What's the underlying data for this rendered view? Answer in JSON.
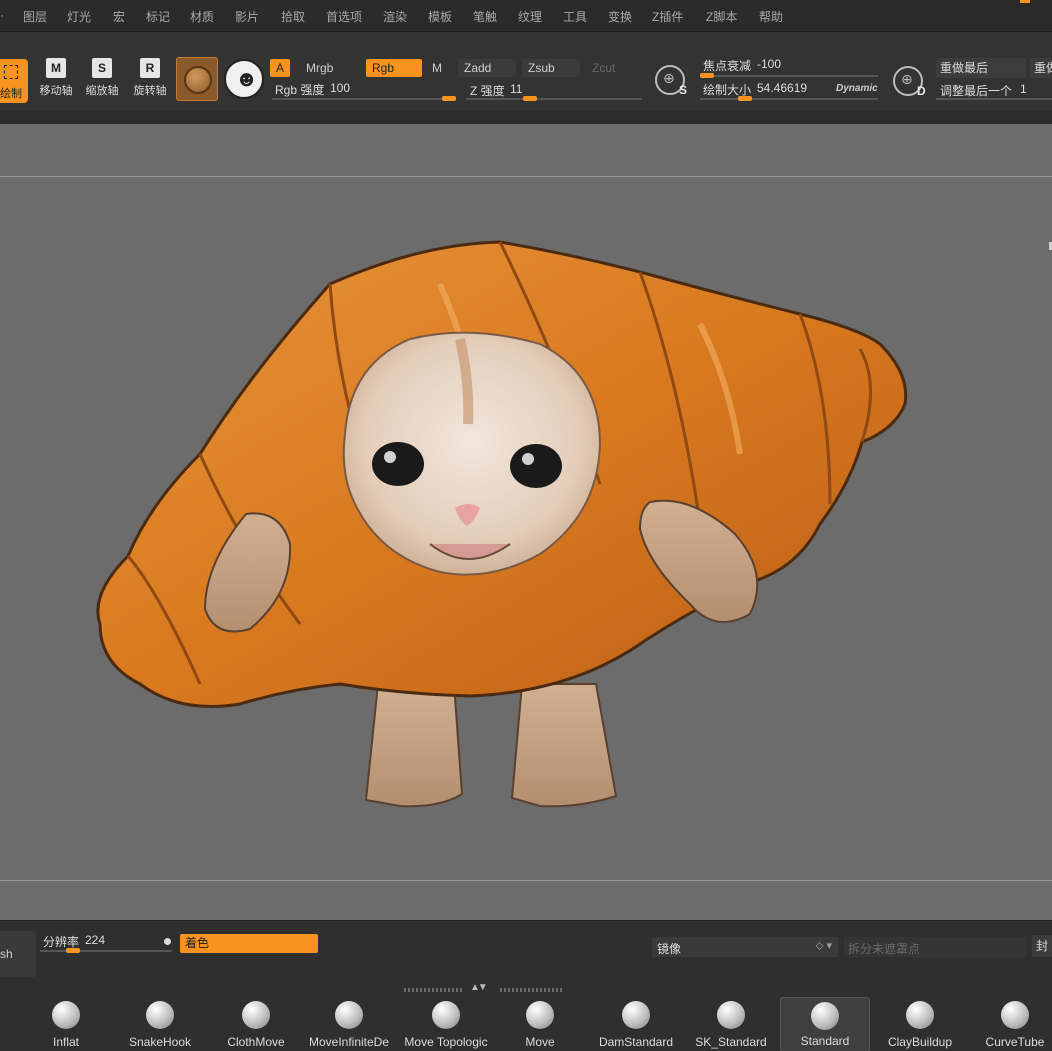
{
  "menu": {
    "items": [
      "图层",
      "灯光",
      "宏",
      "标记",
      "材质",
      "影片",
      "拾取",
      "首选项",
      "渲染",
      "模板",
      "笔触",
      "纹理",
      "工具",
      "变换",
      "Z插件",
      "Z脚本",
      "帮助"
    ]
  },
  "toolbar": {
    "draw_label": "绘制",
    "move_key": "M",
    "move_label": "移动轴",
    "scale_key": "S",
    "scale_label": "缩放轴",
    "rotate_key": "R",
    "rotate_label": "旋转轴",
    "a_label": "A",
    "mrgb_label": "Mrgb",
    "rgb_label": "Rgb",
    "m_label": "M",
    "zadd_label": "Zadd",
    "zsub_label": "Zsub",
    "zcut_label": "Zcut",
    "rgb_intensity_label": "Rgb 强度",
    "rgb_intensity_value": "100",
    "rgb_intensity_level": 1.0,
    "z_intensity_label": "Z 强度",
    "z_intensity_value": "11",
    "z_intensity_level": 0.11,
    "focal_shift_label": "焦点衰减",
    "focal_shift_value": "-100",
    "draw_size_label": "绘制大小",
    "draw_size_value": "54.46619",
    "dynamic_label": "Dynamic",
    "s_key": "S",
    "d_key": "D",
    "redo_last_label": "重做最后",
    "redo_partial_label": "重做",
    "adjust_last_label": "调整最后一个",
    "adjust_last_value": "1"
  },
  "bottom": {
    "brush_stub_label": "sh",
    "resolution_label": "分辨率",
    "resolution_value": "224",
    "color_label": "着色",
    "mirror_label": "镜像",
    "split_label": "拆分未遮罩点",
    "seal_label": "封"
  },
  "brushes": [
    {
      "name": "Inflat"
    },
    {
      "name": "SnakeHook"
    },
    {
      "name": "ClothMove"
    },
    {
      "name": "MoveInfiniteDe"
    },
    {
      "name": "Move Topologic"
    },
    {
      "name": "Move"
    },
    {
      "name": "DamStandard"
    },
    {
      "name": "SK_Standard"
    },
    {
      "name": "Standard"
    },
    {
      "name": "ClayBuildup"
    },
    {
      "name": "CurveTube"
    }
  ],
  "colors": {
    "accent": "#f7931e",
    "viewport": "#6c6c6c",
    "panel": "#333333"
  }
}
